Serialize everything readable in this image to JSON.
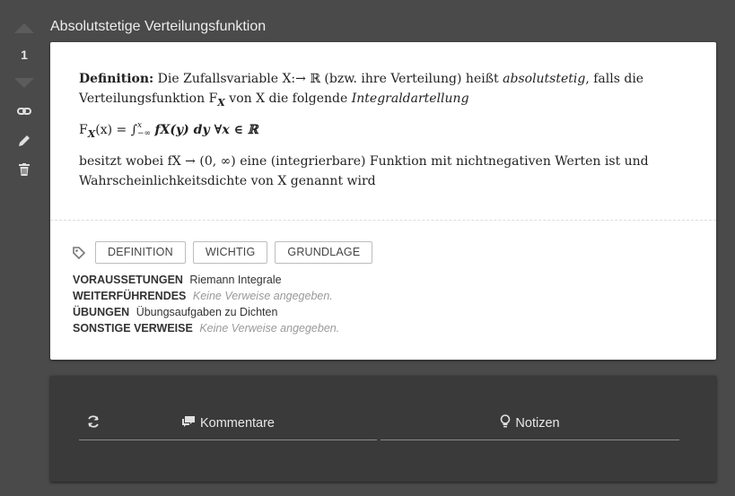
{
  "vote": {
    "count": "1"
  },
  "title": "Absolutstetige Verteilungsfunktion",
  "definition": {
    "label": "Definition:",
    "line1_a": "Die Zufallsvariable X:→ ℝ (bzw. ihre Verteilung) heißt",
    "term": "absolutstetig",
    "line1_b": ", falls die Verteilungsfunktion",
    "F_symbol": "F",
    "F_sub": "X",
    "line1_c": "von X die folgende",
    "term2": "Integraldartellung",
    "formula": "F",
    "formula_sub": "X",
    "formula_rest": "(x) = ∫",
    "integral_sup": "x",
    "integral_sub": "−∞",
    "formula_tail": "fX(y) dy ∀x ∈ ℝ",
    "line2": "besitzt wobei fX → (0, ∞) eine (integrierbare) Funktion mit nichtnegativen Werten ist und Wahrscheinlichkeitsdichte von X genannt wird"
  },
  "tags": [
    "DEFINITION",
    "WICHTIG",
    "GRUNDLAGE"
  ],
  "refs": [
    {
      "key": "VORAUSSETUNGEN",
      "value": "Riemann Integrale",
      "empty": false
    },
    {
      "key": "WEITERFÜHRENDES",
      "value": "Keine Verweise angegeben.",
      "empty": true
    },
    {
      "key": "ÜBUNGEN",
      "value": "Übungsaufgaben zu Dichten",
      "empty": false
    },
    {
      "key": "SONSTIGE VERWEISE",
      "value": "Keine Verweise angegeben.",
      "empty": true
    }
  ],
  "tabs": {
    "comments": "Kommentare",
    "notes": "Notizen"
  },
  "icons": {
    "upvote": "upvote-arrow-icon",
    "downvote": "downvote-arrow-icon",
    "link": "link-icon",
    "edit": "pencil-icon",
    "delete": "trash-icon",
    "tag": "tag-icon",
    "refresh": "refresh-icon",
    "comments": "comments-icon",
    "notes": "lightbulb-icon"
  }
}
